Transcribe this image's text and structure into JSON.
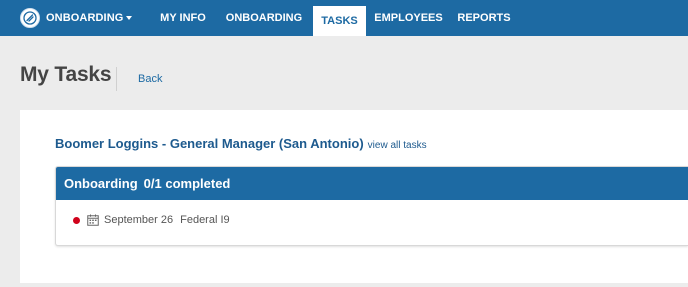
{
  "nav": {
    "brand_label": "ONBOARDING",
    "items": [
      {
        "label": "MY INFO",
        "active": false
      },
      {
        "label": "ONBOARDING",
        "active": false
      },
      {
        "label": "TASKS",
        "active": true
      },
      {
        "label": "EMPLOYEES",
        "active": false
      },
      {
        "label": "REPORTS",
        "active": false
      }
    ],
    "icons": {
      "logo": "logo-icon",
      "dropdown": "chevron-down-icon"
    }
  },
  "header": {
    "title": "My Tasks",
    "back_label": "Back"
  },
  "assignment": {
    "person": "Boomer Loggins - General Manager (San Antonio)",
    "view_all_label": "view all tasks"
  },
  "card": {
    "title": "Onboarding",
    "count": "0/1 completed",
    "tasks": [
      {
        "date": "September 26",
        "name": "Federal I9",
        "status": "incomplete",
        "icon": "calendar-icon"
      }
    ]
  },
  "colors": {
    "primary": "#1d6aa3",
    "link": "#1d5a8e",
    "status_incomplete": "#d0021b",
    "page_bg": "#ececec"
  }
}
